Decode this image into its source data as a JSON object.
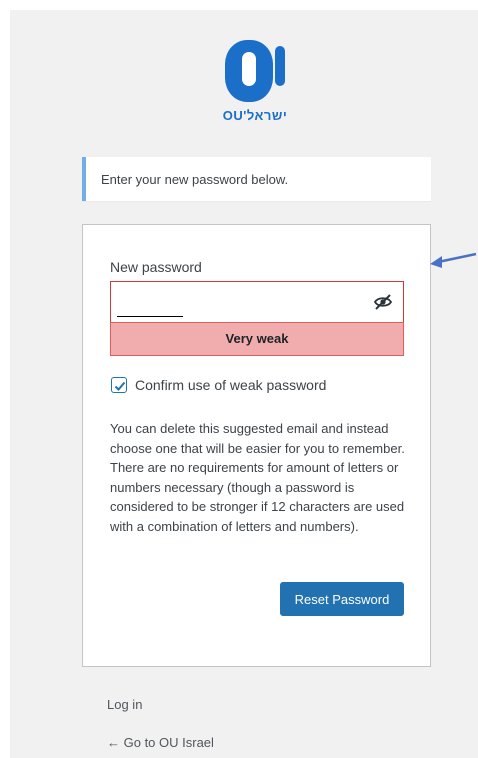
{
  "logo": {
    "text": "OU'ישראל",
    "icon": "ou-logo-icon",
    "brand_color": "#1b6fc9"
  },
  "message": {
    "text": "Enter your new password below."
  },
  "form": {
    "new_password_label": "New password",
    "password_value": "",
    "strength_text": "Very weak",
    "confirm_label": "Confirm use of weak password",
    "confirm_checked": true,
    "hint": "You can delete this suggested email and instead choose one that will be easier for you to remember. There are no requirements for amount of letters or numbers necessary (though a password is considered to be stronger if 12 characters are used with a combination of letters and numbers).",
    "reset_button": "Reset Password"
  },
  "links": {
    "login": "Log in",
    "back": "← Go to OU Israel"
  },
  "colors": {
    "accent": "#2271b1",
    "notice_border": "#72aee6",
    "weak_bg": "#f1adad",
    "weak_border": "#e35b5b",
    "annotation_arrow": "#4a72c4"
  },
  "annotation": {
    "icon": "arrow-left-icon"
  }
}
